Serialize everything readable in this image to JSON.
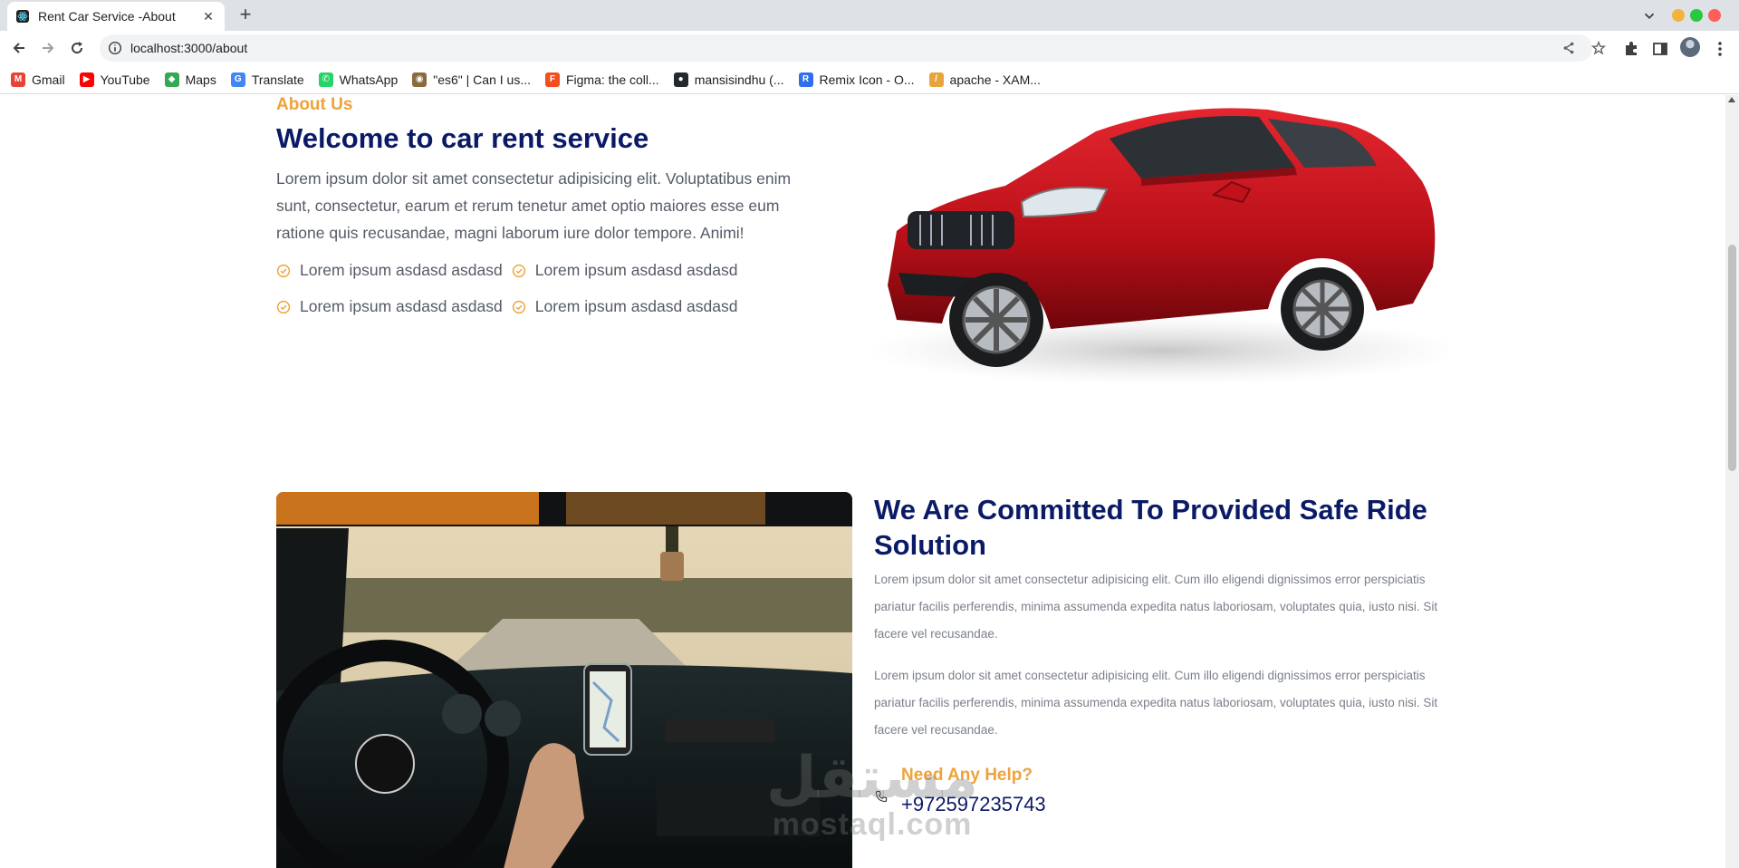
{
  "browser": {
    "tab_title": "Rent Car Service -About",
    "tab_close": "✕",
    "new_tab": "+",
    "url": "localhost:3000/about",
    "window_dot_colors": [
      "#f3b33c",
      "#28c840",
      "#ff5f57"
    ],
    "bookmarks": [
      {
        "label": "Gmail",
        "icon": "gmail-icon",
        "color": "#ea4335",
        "glyph": "M"
      },
      {
        "label": "YouTube",
        "icon": "youtube-icon",
        "color": "#ff0000",
        "glyph": "▶"
      },
      {
        "label": "Maps",
        "icon": "maps-icon",
        "color": "#34a853",
        "glyph": "◆"
      },
      {
        "label": "Translate",
        "icon": "translate-icon",
        "color": "#4285f4",
        "glyph": "G"
      },
      {
        "label": "WhatsApp",
        "icon": "whatsapp-icon",
        "color": "#25d366",
        "glyph": "✆"
      },
      {
        "label": "\"es6\" | Can I us...",
        "icon": "caniuse-icon",
        "color": "#8b6b3d",
        "glyph": "◉"
      },
      {
        "label": "Figma: the coll...",
        "icon": "figma-icon",
        "color": "#f24e1e",
        "glyph": "F"
      },
      {
        "label": "mansisindhu (...",
        "icon": "github-icon",
        "color": "#24292e",
        "glyph": "●"
      },
      {
        "label": "Remix Icon - O...",
        "icon": "remix-icon",
        "color": "#2f6fed",
        "glyph": "R"
      },
      {
        "label": "apache - XAM...",
        "icon": "apache-icon",
        "color": "#e8a33d",
        "glyph": "/"
      }
    ]
  },
  "about": {
    "eyebrow": "About Us",
    "title": "Welcome to car rent service",
    "intro": "Lorem ipsum dolor sit amet consectetur adipisicing elit. Voluptatibus enim sunt, consectetur, earum et rerum tenetur amet optio maiores esse eum ratione quis recusandae, magni laborum iure dolor tempore. Animi!",
    "features": [
      "Lorem ipsum asdasd asdasd",
      "Lorem ipsum asdasd asdasd",
      "Lorem ipsum asdasd asdasd",
      "Lorem ipsum asdasd asdasd"
    ],
    "accent_color": "#f0a23a",
    "heading_color": "#0b1a66"
  },
  "commitment": {
    "title": "We Are Committed To Provided Safe Ride Solution",
    "paragraphs": [
      "Lorem ipsum dolor sit amet consectetur adipisicing elit. Cum illo eligendi dignissimos error perspiciatis pariatur facilis perferendis, minima assumenda expedita natus laboriosam, voluptates quia, iusto nisi. Sit facere vel recusandae.",
      "Lorem ipsum dolor sit amet consectetur adipisicing elit. Cum illo eligendi dignissimos error perspiciatis pariatur facilis perferendis, minima assumenda expedita natus laboriosam, voluptates quia, iusto nisi. Sit facere vel recusandae."
    ],
    "help_title": "Need Any Help?",
    "phone": "+972597235743"
  },
  "watermark": {
    "arabic": "مستقل",
    "latin": "mostaql.com"
  }
}
